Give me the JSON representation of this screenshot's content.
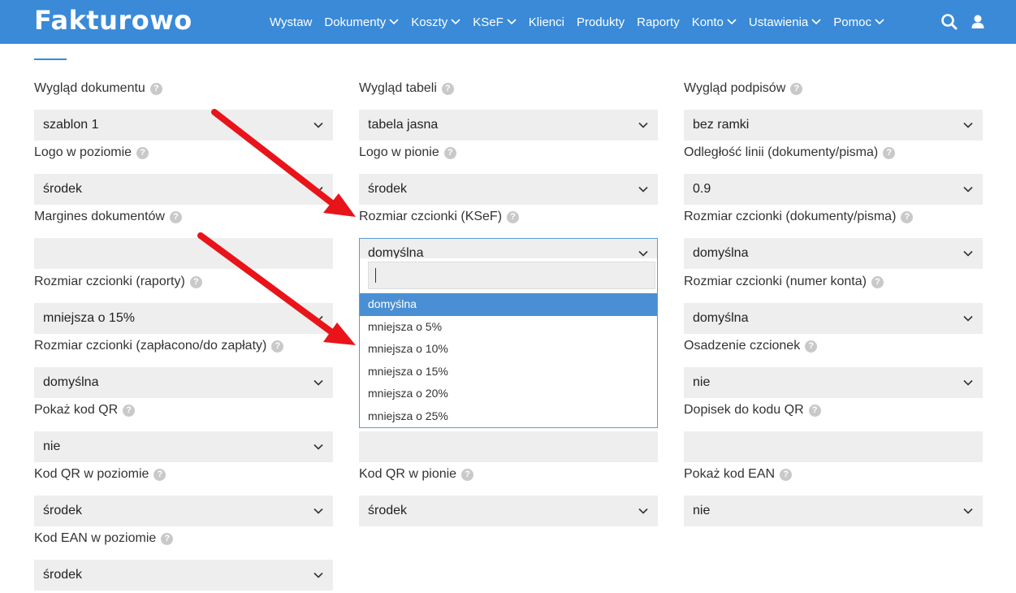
{
  "header": {
    "logo": "Fakturowo",
    "nav": [
      {
        "label": "Wystaw",
        "dropdown": false
      },
      {
        "label": "Dokumenty",
        "dropdown": true
      },
      {
        "label": "Koszty",
        "dropdown": true
      },
      {
        "label": "KSeF",
        "dropdown": true
      },
      {
        "label": "Klienci",
        "dropdown": false
      },
      {
        "label": "Produkty",
        "dropdown": false
      },
      {
        "label": "Raporty",
        "dropdown": false
      },
      {
        "label": "Konto",
        "dropdown": true
      },
      {
        "label": "Ustawienia",
        "dropdown": true
      },
      {
        "label": "Pomoc",
        "dropdown": true
      }
    ],
    "icons": [
      "search-icon",
      "user-icon"
    ]
  },
  "colors": {
    "navbar": "#3a8ad7",
    "field_bg": "#eeeeee",
    "selected_option": "#4a8fd3",
    "focus_border": "#5b9bd5",
    "arrow": "#e8141a"
  },
  "fields": {
    "r1c1": {
      "label": "Wygląd dokumentu",
      "value": "szablon 1"
    },
    "r1c2": {
      "label": "Wygląd tabeli",
      "value": "tabela jasna"
    },
    "r1c3": {
      "label": "Wygląd podpisów",
      "value": "bez ramki"
    },
    "r2c1": {
      "label": "Logo w poziomie",
      "value": "środek"
    },
    "r2c2": {
      "label": "Logo w pionie",
      "value": "środek"
    },
    "r2c3": {
      "label": "Odległość linii (dokumenty/pisma)",
      "value": "0.9"
    },
    "r3c1": {
      "label": "Margines dokumentów",
      "value": ""
    },
    "r3c2": {
      "label": "Rozmiar czcionki (KSeF)",
      "value": "domyślna"
    },
    "r3c3": {
      "label": "Rozmiar czcionki (dokumenty/pisma)",
      "value": "domyślna"
    },
    "r4c1": {
      "label": "Rozmiar czcionki (raporty)",
      "value": "mniejsza o 15%"
    },
    "r4c3": {
      "label": "Rozmiar czcionki (numer konta)",
      "value": "domyślna"
    },
    "r5c1": {
      "label": "Rozmiar czcionki (zapłacono/do zapłaty)",
      "value": "domyślna"
    },
    "r5c3": {
      "label": "Osadzenie czcionek",
      "value": "nie"
    },
    "r6c1": {
      "label": "Pokaż kod QR",
      "value": "nie"
    },
    "r6c3": {
      "label": "Dopisek do kodu QR",
      "value": ""
    },
    "r7c1": {
      "label": "Kod QR w poziomie",
      "value": "środek"
    },
    "r7c2": {
      "label": "Kod QR w pionie",
      "value": "środek"
    },
    "r7c3": {
      "label": "Pokaż kod EAN",
      "value": "nie"
    },
    "r8c1": {
      "label": "Kod EAN w poziomie",
      "value": "środek"
    }
  },
  "dropdown": {
    "search_value": "",
    "selected": "domyślna",
    "options": [
      "domyślna",
      "mniejsza o 5%",
      "mniejsza o 10%",
      "mniejsza o 15%",
      "mniejsza o 20%",
      "mniejsza o 25%"
    ]
  },
  "help_glyph": "?"
}
